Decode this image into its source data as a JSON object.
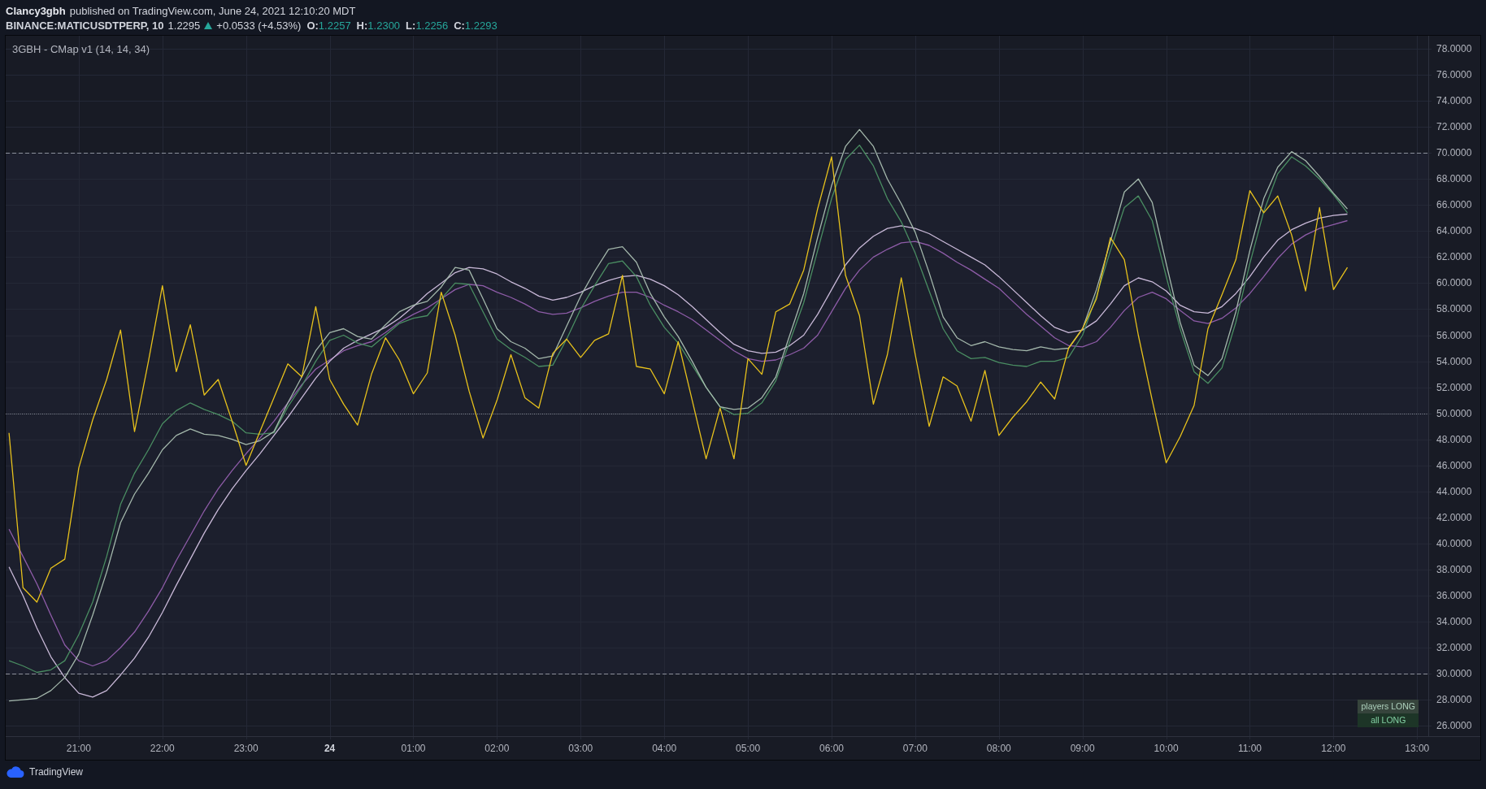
{
  "header": {
    "author": "Clancy3gbh",
    "published": "published on TradingView.com, June 24, 2021 12:10:20 MDT"
  },
  "symbol_bar": {
    "symbol": "BINANCE:MATICUSDTPERP, 10",
    "price": "1.2295",
    "change": "+0.0533 (+4.53%)",
    "ohlc": [
      {
        "label": "O:",
        "value": "1.2257"
      },
      {
        "label": "H:",
        "value": "1.2300"
      },
      {
        "label": "L:",
        "value": "1.2256"
      },
      {
        "label": "C:",
        "value": "1.2293"
      }
    ]
  },
  "chart": {
    "chart_data": {
      "type": "line",
      "title": "3GBH - CMap v1 (14, 14, 34)",
      "categories": [
        null,
        null,
        null,
        null,
        null,
        "21:00",
        null,
        null,
        null,
        null,
        null,
        "22:00",
        null,
        null,
        null,
        null,
        null,
        "23:00",
        null,
        null,
        null,
        null,
        null,
        "24",
        null,
        null,
        null,
        null,
        null,
        "01:00",
        null,
        null,
        null,
        null,
        null,
        "02:00",
        null,
        null,
        null,
        null,
        null,
        "03:00",
        null,
        null,
        null,
        null,
        null,
        "04:00",
        null,
        null,
        null,
        null,
        null,
        "05:00",
        null,
        null,
        null,
        null,
        null,
        "06:00",
        null,
        null,
        null,
        null,
        null,
        "07:00",
        null,
        null,
        null,
        null,
        null,
        "08:00",
        null,
        null,
        null,
        null,
        null,
        "09:00",
        null,
        null,
        null,
        null,
        null,
        "10:00",
        null,
        null,
        null,
        null,
        null,
        "11:00",
        null,
        null,
        null,
        null,
        null,
        "12:00",
        null,
        null,
        null,
        null,
        null,
        "13:00"
      ],
      "ylim": [
        25.2,
        79
      ],
      "grid": true,
      "yticks": [
        {
          "value": 78,
          "label": "78.0000"
        },
        {
          "value": 76,
          "label": "76.0000"
        },
        {
          "value": 74,
          "label": "74.0000"
        },
        {
          "value": 72,
          "label": "72.0000"
        },
        {
          "value": 70,
          "label": "70.0000"
        },
        {
          "value": 68,
          "label": "68.0000"
        },
        {
          "value": 66,
          "label": "66.0000"
        },
        {
          "value": 64,
          "label": "64.0000"
        },
        {
          "value": 62,
          "label": "62.0000"
        },
        {
          "value": 60,
          "label": "60.0000"
        },
        {
          "value": 58,
          "label": "58.0000"
        },
        {
          "value": 56,
          "label": "56.0000"
        },
        {
          "value": 54,
          "label": "54.0000"
        },
        {
          "value": 52,
          "label": "52.0000"
        },
        {
          "value": 50,
          "label": "50.0000"
        },
        {
          "value": 48,
          "label": "48.0000"
        },
        {
          "value": 46,
          "label": "46.0000"
        },
        {
          "value": 44,
          "label": "44.0000"
        },
        {
          "value": 42,
          "label": "42.0000"
        },
        {
          "value": 40,
          "label": "40.0000"
        },
        {
          "value": 38,
          "label": "38.0000"
        },
        {
          "value": 36,
          "label": "36.0000"
        },
        {
          "value": 34,
          "label": "34.0000"
        },
        {
          "value": 32,
          "label": "32.0000"
        },
        {
          "value": 30,
          "label": "30.0000"
        },
        {
          "value": 28,
          "label": "28.0000"
        },
        {
          "value": 26,
          "label": "26.0000"
        }
      ],
      "series": [
        {
          "color": "#8e5ca8",
          "values": [
            41.1,
            39.0,
            36.9,
            34.5,
            32.2,
            31.0,
            30.6,
            31.0,
            32.0,
            33.2,
            34.8,
            36.6,
            38.7,
            40.6,
            42.5,
            44.2,
            45.6,
            46.9,
            48.1,
            49.4,
            50.8,
            52.2,
            53.4,
            54.1,
            54.8,
            55.2,
            55.5,
            56.2,
            57.0,
            57.6,
            58.1,
            58.8,
            59.5,
            59.9,
            59.8,
            59.3,
            58.9,
            58.4,
            57.8,
            57.6,
            57.7,
            58.1,
            58.6,
            59.0,
            59.3,
            59.3,
            58.9,
            58.3,
            57.8,
            57.2,
            56.4,
            55.6,
            54.8,
            54.2,
            54.0,
            54.1,
            54.5,
            55.0,
            56.0,
            57.8,
            59.6,
            61.0,
            62.0,
            62.6,
            63.1,
            63.2,
            62.9,
            62.3,
            61.6,
            61.0,
            60.3,
            59.6,
            58.6,
            57.6,
            56.7,
            55.8,
            55.2,
            55.1,
            55.5,
            56.6,
            57.9,
            58.9,
            59.3,
            58.8,
            57.9,
            57.1,
            56.9,
            57.3,
            58.1,
            59.2,
            60.5,
            61.9,
            63.0,
            63.7,
            64.2,
            64.5,
            64.8,
            null,
            null,
            null,
            null,
            null
          ]
        },
        {
          "color": "#c9b9d8",
          "values": [
            38.2,
            36.0,
            33.5,
            31.3,
            29.7,
            28.5,
            28.2,
            28.7,
            29.9,
            31.2,
            32.8,
            34.7,
            36.8,
            38.8,
            40.8,
            42.6,
            44.2,
            45.6,
            46.9,
            48.3,
            49.7,
            51.2,
            52.7,
            54.0,
            55.0,
            55.6,
            56.1,
            56.6,
            57.3,
            58.2,
            59.2,
            60.0,
            60.8,
            61.2,
            61.1,
            60.7,
            60.1,
            59.6,
            59.0,
            58.7,
            58.9,
            59.3,
            59.8,
            60.2,
            60.5,
            60.6,
            60.3,
            59.8,
            59.1,
            58.2,
            57.2,
            56.2,
            55.3,
            54.8,
            54.6,
            54.7,
            55.2,
            56.0,
            57.6,
            59.5,
            61.4,
            62.7,
            63.6,
            64.2,
            64.4,
            64.2,
            63.8,
            63.2,
            62.6,
            62.0,
            61.4,
            60.5,
            59.5,
            58.5,
            57.5,
            56.6,
            56.2,
            56.4,
            57.1,
            58.4,
            59.8,
            60.4,
            60.1,
            59.4,
            58.3,
            57.8,
            57.7,
            58.2,
            59.2,
            60.5,
            62.0,
            63.3,
            64.1,
            64.6,
            65.0,
            65.2,
            65.3,
            null,
            null,
            null,
            null,
            null
          ]
        },
        {
          "color": "#4a8d62",
          "values": [
            31.0,
            30.6,
            30.1,
            30.3,
            31.0,
            33.0,
            35.5,
            39.0,
            43.0,
            45.4,
            47.2,
            49.2,
            50.2,
            50.8,
            50.3,
            49.9,
            49.4,
            48.5,
            48.4,
            48.5,
            50.5,
            52.1,
            54.0,
            55.6,
            56.0,
            55.4,
            55.1,
            56.0,
            56.9,
            57.3,
            57.5,
            58.8,
            60.0,
            59.9,
            57.8,
            55.7,
            54.9,
            54.3,
            53.6,
            53.7,
            55.7,
            58.0,
            59.8,
            61.5,
            61.7,
            60.5,
            58.3,
            56.6,
            55.4,
            53.7,
            52.0,
            50.5,
            49.9,
            50.0,
            50.8,
            52.5,
            55.5,
            58.5,
            62.5,
            66.5,
            69.5,
            70.6,
            69.0,
            66.5,
            64.7,
            62.3,
            59.4,
            56.5,
            54.8,
            54.2,
            54.3,
            53.9,
            53.7,
            53.6,
            54.0,
            54.0,
            54.3,
            56.0,
            59.0,
            62.5,
            65.8,
            66.7,
            64.8,
            60.5,
            56.5,
            53.2,
            52.3,
            53.5,
            57.0,
            61.5,
            65.5,
            68.4,
            69.7,
            69.0,
            68.0,
            66.8,
            65.4,
            null,
            null,
            null,
            null,
            null
          ]
        },
        {
          "color": "#a4b8ac",
          "values": [
            27.9,
            28.0,
            28.1,
            28.7,
            29.7,
            31.5,
            34.5,
            37.8,
            41.6,
            43.8,
            45.4,
            47.2,
            48.3,
            48.8,
            48.4,
            48.3,
            48.0,
            47.6,
            47.9,
            48.6,
            50.8,
            52.8,
            54.8,
            56.2,
            56.5,
            55.9,
            55.7,
            56.8,
            57.8,
            58.3,
            58.6,
            59.7,
            61.2,
            61.0,
            58.8,
            56.5,
            55.5,
            55.0,
            54.2,
            54.4,
            56.7,
            59.0,
            60.9,
            62.6,
            62.8,
            61.6,
            59.2,
            57.4,
            55.9,
            54.0,
            52.0,
            50.5,
            50.3,
            50.4,
            51.2,
            52.8,
            56.0,
            59.2,
            63.5,
            67.5,
            70.5,
            71.8,
            70.5,
            68.0,
            66.1,
            63.9,
            60.8,
            57.4,
            55.8,
            55.2,
            55.5,
            55.1,
            54.9,
            54.8,
            55.1,
            54.9,
            55.0,
            56.5,
            59.5,
            63.2,
            67.0,
            68.0,
            66.2,
            61.5,
            57.0,
            53.7,
            52.9,
            54.2,
            57.8,
            62.5,
            66.5,
            68.9,
            70.1,
            69.4,
            68.2,
            66.9,
            65.7,
            null,
            null,
            null,
            null,
            null
          ]
        },
        {
          "color": "#e8c21c",
          "values": [
            48.5,
            36.6,
            35.5,
            38.1,
            38.8,
            45.8,
            49.5,
            52.6,
            56.4,
            48.6,
            54.0,
            59.8,
            53.2,
            56.8,
            51.4,
            52.6,
            49.4,
            46.0,
            48.6,
            51.2,
            53.8,
            52.8,
            58.2,
            52.6,
            50.7,
            49.1,
            53.0,
            55.8,
            54.1,
            51.5,
            53.1,
            59.3,
            56.0,
            51.7,
            48.1,
            51.0,
            54.5,
            51.2,
            50.4,
            54.6,
            55.7,
            54.3,
            55.6,
            56.1,
            60.6,
            53.6,
            53.4,
            51.5,
            55.5,
            51.0,
            46.5,
            50.4,
            46.5,
            54.2,
            53.0,
            57.8,
            58.4,
            61.0,
            65.7,
            69.7,
            60.6,
            57.5,
            50.7,
            54.5,
            60.4,
            54.5,
            49.0,
            52.8,
            52.1,
            49.4,
            53.3,
            48.3,
            49.7,
            50.9,
            52.4,
            51.1,
            55.0,
            56.5,
            58.8,
            63.5,
            61.8,
            56.0,
            51.0,
            46.2,
            48.2,
            50.6,
            56.5,
            59.1,
            61.8,
            67.1,
            65.4,
            66.7,
            63.7,
            59.4,
            65.8,
            59.5,
            61.2,
            null,
            null,
            null,
            null,
            null
          ]
        }
      ],
      "bands": [
        {
          "axis": "y",
          "from": 30,
          "to": 70
        }
      ]
    }
  },
  "signal_table": [
    {
      "text": "players LONG",
      "color": "#36443c"
    },
    {
      "text": "all LONG",
      "color": "#1d3527"
    }
  ],
  "footer": {
    "brand": "TradingView"
  }
}
